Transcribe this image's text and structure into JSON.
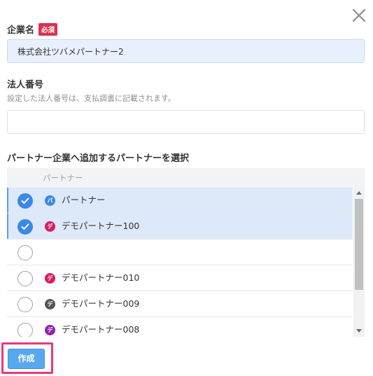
{
  "form": {
    "company_name": {
      "label": "企業名",
      "required_badge": "必須",
      "value": "株式会社ツバメパートナー2"
    },
    "corporate_number": {
      "label": "法人番号",
      "help": "設定した法人番号は、支払調書に記載されます。",
      "value": ""
    },
    "partner_select": {
      "label": "パートナー企業へ追加するパートナーを選択",
      "column_header": "パートナー",
      "rows": [
        {
          "name": "パートナー",
          "avatar": "パ",
          "avatar_color": "#3d87e6",
          "checked": true
        },
        {
          "name": "デモパートナー100",
          "avatar": "デ",
          "avatar_color": "#d81b60",
          "checked": true
        },
        {
          "name": "",
          "avatar": "",
          "avatar_color": "",
          "checked": false
        },
        {
          "name": "デモパートナー010",
          "avatar": "デ",
          "avatar_color": "#d81b60",
          "checked": false
        },
        {
          "name": "デモパートナー009",
          "avatar": "デ",
          "avatar_color": "#555555",
          "checked": false
        },
        {
          "name": "デモパートナー008",
          "avatar": "デ",
          "avatar_color": "#8e24aa",
          "checked": false
        }
      ]
    },
    "create_button": "作成"
  },
  "colors": {
    "accent": "#3d87e6",
    "required": "#d9334f",
    "highlight": "#e8397a"
  }
}
